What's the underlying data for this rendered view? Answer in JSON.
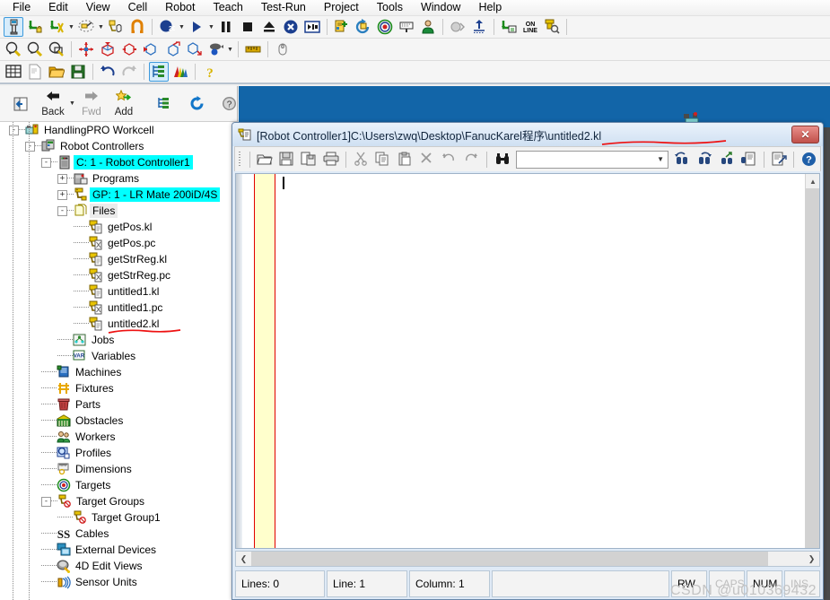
{
  "menubar": {
    "items": [
      {
        "label": "File",
        "name": "menu-file"
      },
      {
        "label": "Edit",
        "name": "menu-edit"
      },
      {
        "label": "View",
        "name": "menu-view"
      },
      {
        "label": "Cell",
        "name": "menu-cell"
      },
      {
        "label": "Robot",
        "name": "menu-robot"
      },
      {
        "label": "Teach",
        "name": "menu-teach"
      },
      {
        "label": "Test-Run",
        "name": "menu-test-run"
      },
      {
        "label": "Project",
        "name": "menu-project"
      },
      {
        "label": "Tools",
        "name": "menu-tools"
      },
      {
        "label": "Window",
        "name": "menu-window"
      },
      {
        "label": "Help",
        "name": "menu-help"
      }
    ]
  },
  "toolbar1": {
    "icons": [
      "teach-pendant-icon",
      "jog-lock-icon",
      "jog-coord-icon",
      "dropdown-arrow-icon",
      "pick-tool-icon",
      "dropdown-arrow-icon",
      "hand-teach-icon",
      "magnet-icon",
      "separator",
      "view-2d-icon",
      "dropdown-arrow-icon",
      "run-icon",
      "dropdown-arrow-icon",
      "pause-icon",
      "stop-icon",
      "eject-icon",
      "abort-icon",
      "step-icon",
      "separator",
      "program-adjust-icon",
      "cycle-icon",
      "target-icon",
      "label-icon",
      "worker-icon",
      "separator",
      "shadow-icon",
      "upload-icon",
      "separator",
      "teach-data-icon",
      "online-icon",
      "robot-search-icon",
      "separator"
    ]
  },
  "toolbar2": {
    "icons": [
      "zoom-in-icon",
      "zoom-out-icon",
      "zoom-window-icon",
      "separator",
      "center-move-icon",
      "move-up-icon",
      "move-box-left-icon",
      "move-box-right-icon",
      "move-box-out-icon",
      "move-box-in-icon",
      "camera-icon",
      "dropdown-arrow-icon",
      "separator",
      "measure-icon",
      "separator",
      "mouse-icon"
    ]
  },
  "toolbar3": {
    "icons": [
      "grid-icon",
      "new-doc-icon",
      "open-folder-icon",
      "save-icon",
      "separator",
      "undo-icon",
      "redo-icon",
      "separator",
      "cell-browser-icon",
      "chart-icon",
      "separator",
      "help-icon"
    ]
  },
  "navbar": {
    "browse_icon": "browse-icon",
    "back_label": "Back",
    "fwd_label": "Fwd",
    "add_label": "Add",
    "tree_icon": "tree-icon",
    "refresh_icon": "refresh-icon",
    "help_icon": "help-icon"
  },
  "tree": {
    "nodes": [
      {
        "label": "HandlingPRO Workcell",
        "icon": "workcell-icon",
        "depth": 0,
        "expander": "-",
        "state": "normal",
        "name": "tree-node-handlingpro-workcell"
      },
      {
        "label": "Robot Controllers",
        "icon": "controllers-icon",
        "depth": 1,
        "expander": "-",
        "state": "normal",
        "name": "tree-node-robot-controllers"
      },
      {
        "label": "C: 1 - Robot Controller1",
        "icon": "controller-icon",
        "depth": 2,
        "expander": "-",
        "state": "selected",
        "name": "tree-node-robot-controller1"
      },
      {
        "label": "Programs",
        "icon": "programs-icon",
        "depth": 3,
        "expander": "+",
        "state": "normal",
        "name": "tree-node-programs"
      },
      {
        "label": "GP: 1 - LR Mate 200iD/4S",
        "icon": "robot-icon",
        "depth": 3,
        "expander": "+",
        "state": "selected",
        "name": "tree-node-gp1-lrmate"
      },
      {
        "label": "Files",
        "icon": "files-icon",
        "depth": 3,
        "expander": "-",
        "state": "grey",
        "name": "tree-node-files"
      },
      {
        "label": "getPos.kl",
        "icon": "kl-file-icon",
        "depth": 4,
        "expander": "",
        "state": "normal",
        "name": "tree-node-getpos-kl"
      },
      {
        "label": "getPos.pc",
        "icon": "pc-file-icon",
        "depth": 4,
        "expander": "",
        "state": "normal",
        "name": "tree-node-getpos-pc"
      },
      {
        "label": "getStrReg.kl",
        "icon": "kl-file-icon",
        "depth": 4,
        "expander": "",
        "state": "normal",
        "name": "tree-node-getstrreg-kl"
      },
      {
        "label": "getStrReg.pc",
        "icon": "pc-file-icon",
        "depth": 4,
        "expander": "",
        "state": "normal",
        "name": "tree-node-getstrreg-pc"
      },
      {
        "label": "untitled1.kl",
        "icon": "kl-file-icon",
        "depth": 4,
        "expander": "",
        "state": "normal",
        "name": "tree-node-untitled1-kl"
      },
      {
        "label": "untitled1.pc",
        "icon": "pc-file-icon",
        "depth": 4,
        "expander": "",
        "state": "normal",
        "name": "tree-node-untitled1-pc"
      },
      {
        "label": "untitled2.kl",
        "icon": "kl-file-icon",
        "depth": 4,
        "expander": "",
        "state": "underlined",
        "name": "tree-node-untitled2-kl"
      },
      {
        "label": "Jobs",
        "icon": "jobs-icon",
        "depth": 3,
        "expander": "",
        "state": "normal",
        "name": "tree-node-jobs"
      },
      {
        "label": "Variables",
        "icon": "variables-icon",
        "depth": 3,
        "expander": "",
        "state": "normal",
        "name": "tree-node-variables"
      },
      {
        "label": "Machines",
        "icon": "machines-icon",
        "depth": 2,
        "expander": "",
        "state": "normal",
        "name": "tree-node-machines"
      },
      {
        "label": "Fixtures",
        "icon": "fixtures-icon",
        "depth": 2,
        "expander": "",
        "state": "normal",
        "name": "tree-node-fixtures"
      },
      {
        "label": "Parts",
        "icon": "parts-icon",
        "depth": 2,
        "expander": "",
        "state": "normal",
        "name": "tree-node-parts"
      },
      {
        "label": "Obstacles",
        "icon": "obstacles-icon",
        "depth": 2,
        "expander": "",
        "state": "normal",
        "name": "tree-node-obstacles"
      },
      {
        "label": "Workers",
        "icon": "workers-icon",
        "depth": 2,
        "expander": "",
        "state": "normal",
        "name": "tree-node-workers"
      },
      {
        "label": "Profiles",
        "icon": "profiles-icon",
        "depth": 2,
        "expander": "",
        "state": "normal",
        "name": "tree-node-profiles"
      },
      {
        "label": "Dimensions",
        "icon": "dimensions-icon",
        "depth": 2,
        "expander": "",
        "state": "normal",
        "name": "tree-node-dimensions"
      },
      {
        "label": "Targets",
        "icon": "targets-icon",
        "depth": 2,
        "expander": "",
        "state": "normal",
        "name": "tree-node-targets"
      },
      {
        "label": "Target Groups",
        "icon": "target-groups-icon",
        "depth": 2,
        "expander": "-",
        "state": "normal",
        "name": "tree-node-target-groups"
      },
      {
        "label": "Target Group1",
        "icon": "target-groups-icon",
        "depth": 3,
        "expander": "",
        "state": "normal",
        "name": "tree-node-target-group1"
      },
      {
        "label": "Cables",
        "icon": "cables-icon",
        "depth": 2,
        "expander": "",
        "state": "normal",
        "name": "tree-node-cables"
      },
      {
        "label": "External Devices",
        "icon": "external-devices-icon",
        "depth": 2,
        "expander": "",
        "state": "normal",
        "name": "tree-node-external-devices"
      },
      {
        "label": "4D Edit Views",
        "icon": "4d-edit-views-icon",
        "depth": 2,
        "expander": "",
        "state": "normal",
        "name": "tree-node-4d-edit-views"
      },
      {
        "label": "Sensor Units",
        "icon": "sensor-units-icon",
        "depth": 2,
        "expander": "",
        "state": "normal",
        "name": "tree-node-sensor-units"
      }
    ]
  },
  "editor": {
    "title": "[Robot Controller1]C:\\Users\\zwq\\Desktop\\FanucKarel程序\\untitled2.kl",
    "title_icon": "karel-editor-icon",
    "close_label": "✕",
    "toolbar_icons": [
      "open-icon",
      "save-icon",
      "save-as-icon",
      "print-icon",
      "separator",
      "cut-icon",
      "copy-icon",
      "paste-icon",
      "delete-icon",
      "undo-icon",
      "redo-icon",
      "separator",
      "find-icon"
    ],
    "toolbar_icons_after": [
      "find-prev-icon",
      "find-next-icon",
      "find-in-files-icon",
      "replace-icon",
      "separator",
      "go-to-icon",
      "separator",
      "help-icon"
    ],
    "find_value": "",
    "find_placeholder": "",
    "text_content": "",
    "status": {
      "lines": "Lines: 0",
      "line": "Line: 1",
      "column": "Column: 1",
      "message": "",
      "rw": "RW",
      "caps": "CAPS",
      "num": "NUM",
      "ins": "INS"
    }
  },
  "watermark": "CSDN @u010369432",
  "colors": {
    "selection": "#00ffff",
    "viewport": "#1265a8",
    "gutter": "#ffffcc",
    "gutter_border": "#e00000",
    "annotation": "#ee1111",
    "close_button": "#c0504a"
  }
}
